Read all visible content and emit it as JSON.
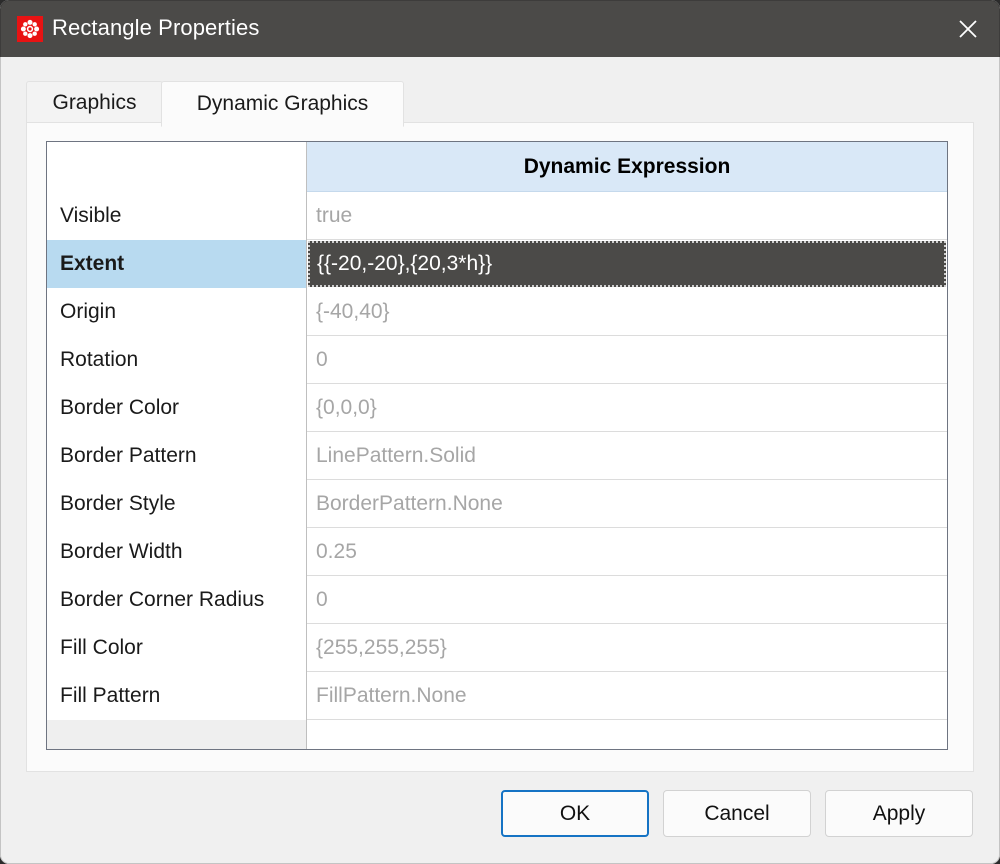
{
  "window": {
    "title": "Rectangle Properties",
    "icon": "modelica-flower-icon",
    "close_label": "✕",
    "titlebar_color": "#4b4a48",
    "icon_color": "#e81313"
  },
  "tabs": [
    {
      "label": "Graphics",
      "active": false
    },
    {
      "label": "Dynamic Graphics",
      "active": true
    }
  ],
  "table": {
    "columns": [
      "",
      "Dynamic Expression"
    ],
    "header_label": "Dynamic Expression",
    "selected_row_index": 1,
    "rows": [
      {
        "name": "Visible",
        "value": "true"
      },
      {
        "name": "Extent",
        "value": "{{-20,-20},{20,3*h}}"
      },
      {
        "name": "Origin",
        "value": "{-40,40}"
      },
      {
        "name": "Rotation",
        "value": "0"
      },
      {
        "name": "Border Color",
        "value": "{0,0,0}"
      },
      {
        "name": "Border Pattern",
        "value": "LinePattern.Solid"
      },
      {
        "name": "Border Style",
        "value": "BorderPattern.None"
      },
      {
        "name": "Border Width",
        "value": "0.25"
      },
      {
        "name": "Border Corner Radius",
        "value": "0"
      },
      {
        "name": "Fill Color",
        "value": "{255,255,255}"
      },
      {
        "name": "Fill Pattern",
        "value": "FillPattern.None"
      }
    ],
    "header_bg": "#d9e8f7",
    "selected_bg": "#b8daf0",
    "editor_bg": "#4b4a48"
  },
  "buttons": {
    "ok": "OK",
    "cancel": "Cancel",
    "apply": "Apply",
    "primary_border": "#1573c4"
  }
}
